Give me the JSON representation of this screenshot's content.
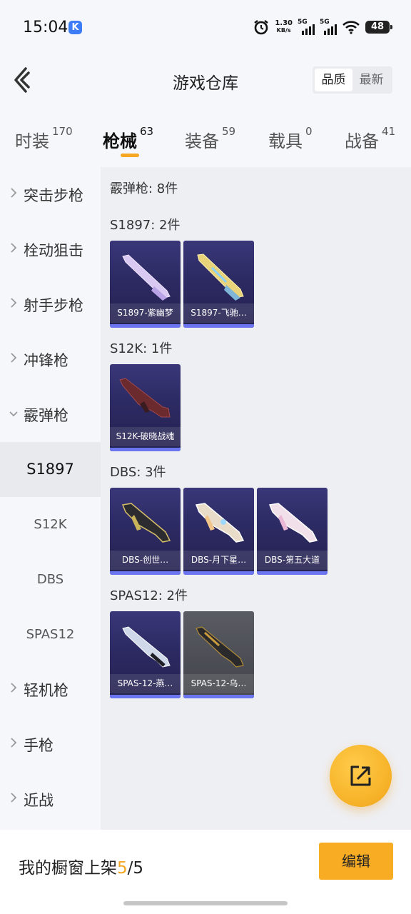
{
  "status_bar": {
    "time": "15:04",
    "app_badge": "K",
    "net_speed_value": "1.30",
    "net_speed_unit": "KB/s",
    "signal_1_label": "5G",
    "signal_2_label": "5G",
    "battery": "48"
  },
  "header": {
    "title": "游戏仓库",
    "sort_options": [
      "品质",
      "最新"
    ],
    "sort_active": "品质"
  },
  "tabs": [
    {
      "label": "时装",
      "count": "170"
    },
    {
      "label": "枪械",
      "count": "63"
    },
    {
      "label": "装备",
      "count": "59"
    },
    {
      "label": "载具",
      "count": "0"
    },
    {
      "label": "战备",
      "count": "41"
    }
  ],
  "sidebar": {
    "categories": [
      "突击步枪",
      "栓动狙击",
      "射手步枪",
      "冲锋枪",
      "霰弹枪",
      "轻机枪",
      "手枪",
      "近战"
    ],
    "subitems": [
      "S1897",
      "S12K",
      "DBS",
      "SPAS12"
    ]
  },
  "content": {
    "category_header": "霰弹枪: 8件",
    "groups": [
      {
        "header": "S1897: 2件",
        "items": [
          "S1897-紫幽梦",
          "S1897-飞驰…"
        ]
      },
      {
        "header": "S12K: 1件",
        "items": [
          "S12K-破晓战魂"
        ]
      },
      {
        "header": "DBS: 3件",
        "items": [
          "DBS-创世…",
          "DBS-月下星…",
          "DBS-第五大道"
        ]
      },
      {
        "header": "SPAS12: 2件",
        "items": [
          "SPAS-12-燕…",
          "SPAS-12-乌…"
        ]
      }
    ]
  },
  "footer": {
    "label": "我的橱窗上架",
    "current": "5",
    "separator": "/",
    "total": "5",
    "edit_label": "编辑"
  },
  "colors": {
    "accent": "#f5a623",
    "card_bg": "#2e2c66",
    "card_bar": "#6c75f0"
  }
}
